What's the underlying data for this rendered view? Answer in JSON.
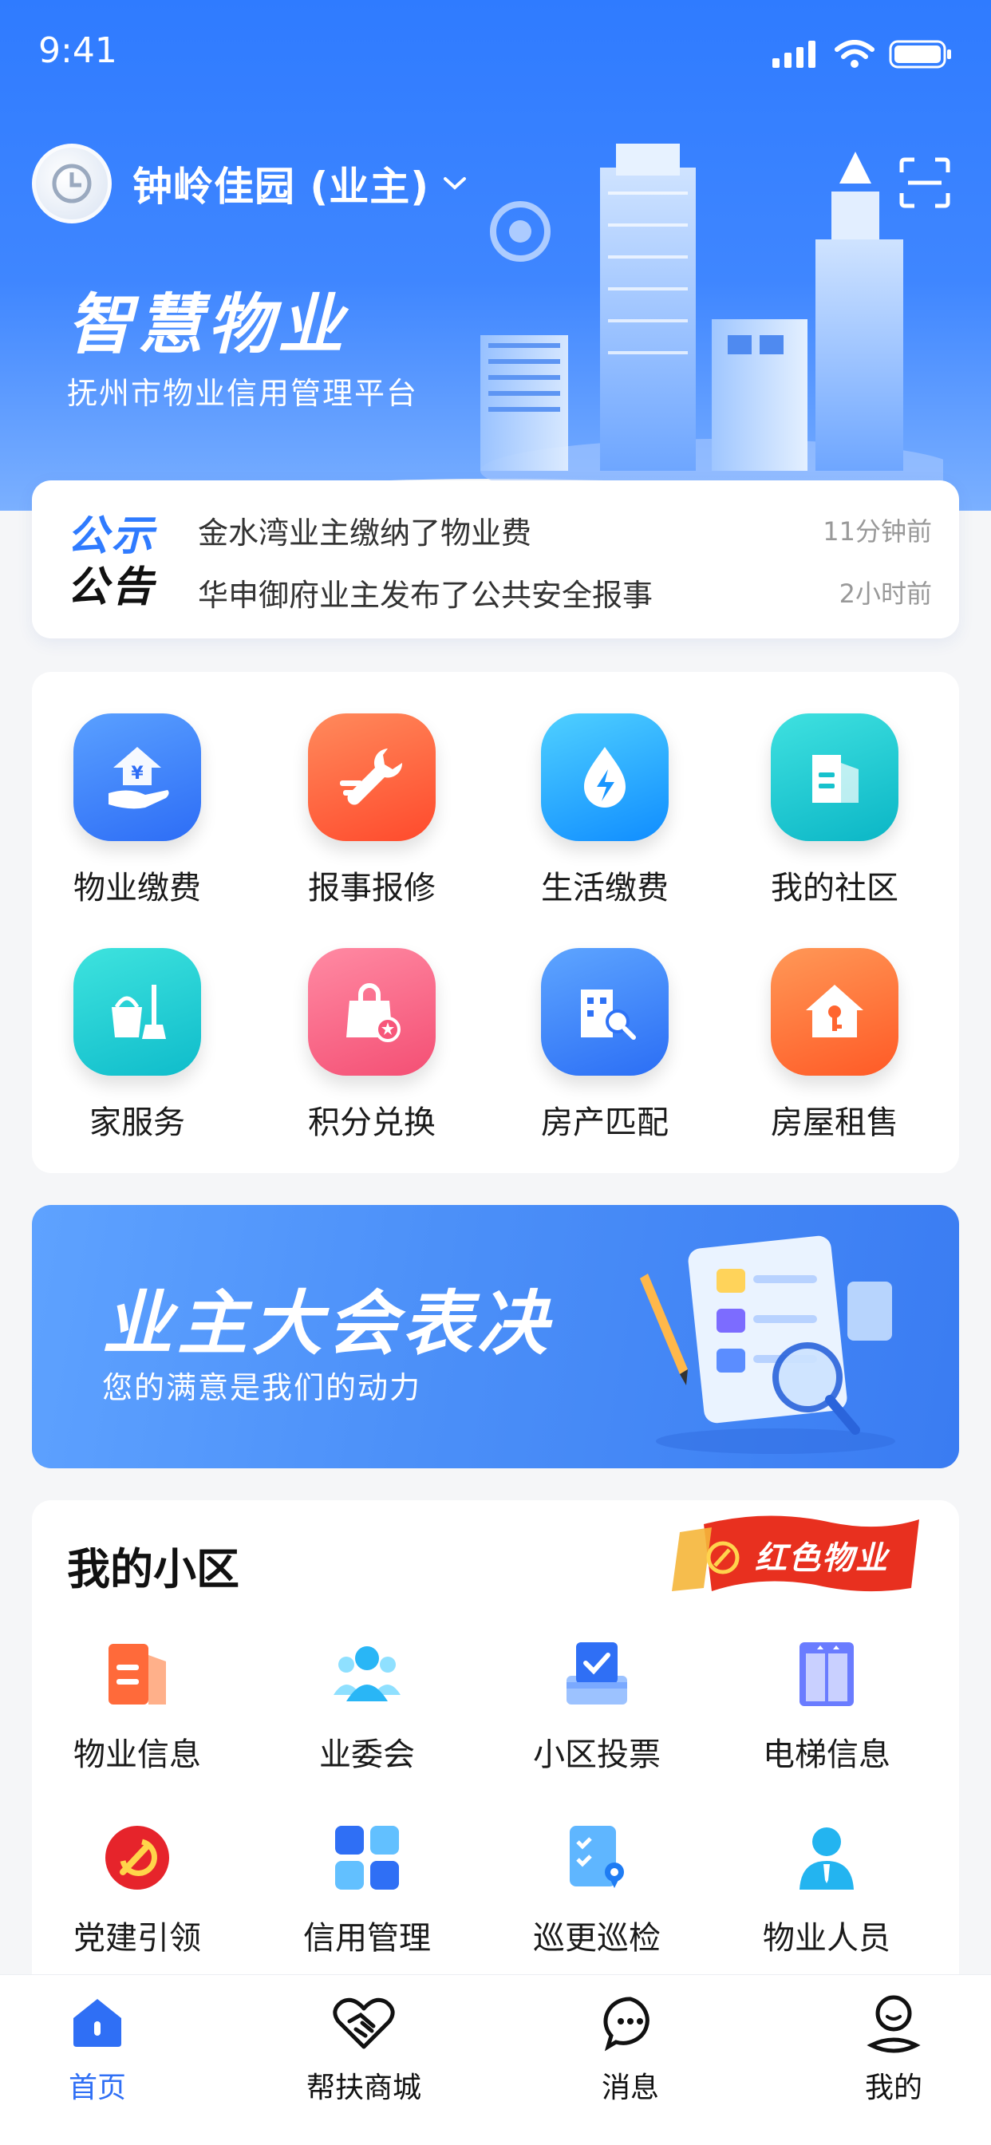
{
  "status_bar": {
    "time": "9:41"
  },
  "header": {
    "community_name": "钟岭佳园 (业主)",
    "brand_title": "智慧物业",
    "brand_subtitle": "抚州市物业信用管理平台"
  },
  "notice": {
    "tag_line1": "公示",
    "tag_line2": "公告",
    "items": [
      {
        "message": "金水湾业主缴纳了物业费",
        "time": "11分钟前"
      },
      {
        "message": "华申御府业主发布了公共安全报事",
        "time": "2小时前"
      }
    ]
  },
  "services": [
    {
      "label": "物业缴费",
      "icon": "property-payment-icon",
      "color": "#3d86ff"
    },
    {
      "label": "报事报修",
      "icon": "repair-wrench-icon",
      "color": "#ff5a3c"
    },
    {
      "label": "生活缴费",
      "icon": "water-drop-icon",
      "color": "#1ea7ff"
    },
    {
      "label": "我的社区",
      "icon": "community-building-icon",
      "color": "#16c9d3"
    },
    {
      "label": "家服务",
      "icon": "cleaning-icon",
      "color": "#19cbd6"
    },
    {
      "label": "积分兑换",
      "icon": "shopping-bag-icon",
      "color": "#ff5f7e"
    },
    {
      "label": "房产匹配",
      "icon": "building-search-icon",
      "color": "#3a86ff"
    },
    {
      "label": "房屋租售",
      "icon": "house-key-icon",
      "color": "#ff6a2f"
    }
  ],
  "banner": {
    "title": "业主大会表决",
    "subtitle": "您的满意是我们的动力"
  },
  "my_community": {
    "title": "我的小区",
    "badge": "红色物业",
    "items": [
      {
        "label": "物业信息",
        "icon": "property-info-icon"
      },
      {
        "label": "业委会",
        "icon": "committee-people-icon"
      },
      {
        "label": "小区投票",
        "icon": "vote-box-icon"
      },
      {
        "label": "电梯信息",
        "icon": "elevator-icon"
      },
      {
        "label": "党建引领",
        "icon": "party-emblem-icon"
      },
      {
        "label": "信用管理",
        "icon": "grid-apps-icon"
      },
      {
        "label": "巡更巡检",
        "icon": "inspection-checklist-icon"
      },
      {
        "label": "物业人员",
        "icon": "staff-person-icon"
      }
    ]
  },
  "tabbar": {
    "items": [
      {
        "label": "首页",
        "icon": "home-icon",
        "active": true
      },
      {
        "label": "帮扶商城",
        "icon": "handshake-heart-icon",
        "active": false
      },
      {
        "label": "消息",
        "icon": "message-bubble-icon",
        "active": false
      },
      {
        "label": "我的",
        "icon": "profile-icon",
        "active": false
      }
    ]
  }
}
